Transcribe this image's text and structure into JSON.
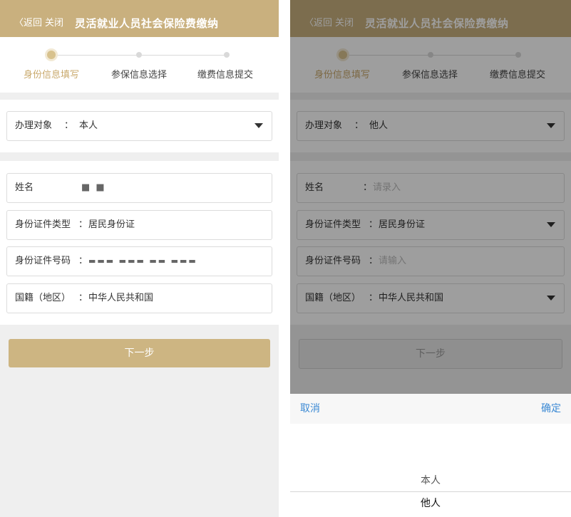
{
  "header": {
    "back_label": "〈返回",
    "close_label": "关闭",
    "title": "灵活就业人员社会保险费缴纳"
  },
  "steps": [
    "身份信息填写",
    "参保信息选择",
    "缴费信息提交"
  ],
  "left": {
    "target": {
      "label": "办理对象",
      "value": "本人"
    },
    "name": {
      "label": "姓名",
      "value": "■ ■"
    },
    "id_type": {
      "label": "身份证件类型",
      "value": "居民身份证"
    },
    "id_number": {
      "label": "身份证件号码",
      "value": "▬▬▬ ▬▬▬ ▬▬ ▬▬▬"
    },
    "nationality": {
      "label": "国籍（地区）",
      "value": "中华人民共和国"
    },
    "next_label": "下一步"
  },
  "right": {
    "target": {
      "label": "办理对象",
      "value": "他人"
    },
    "name": {
      "label": "姓名",
      "placeholder": "请录入"
    },
    "id_type": {
      "label": "身份证件类型",
      "value": "居民身份证"
    },
    "id_number": {
      "label": "身份证件号码",
      "placeholder": "请输入"
    },
    "nationality": {
      "label": "国籍（地区）",
      "value": "中华人民共和国"
    },
    "next_label": "下一步"
  },
  "picker": {
    "cancel": "取消",
    "confirm": "确定",
    "options": [
      "本人",
      "他人"
    ],
    "selected": "他人"
  },
  "colors": {
    "accent": "#c9b07e",
    "active_step": "#c9a96c",
    "link": "#3c8ad4"
  }
}
